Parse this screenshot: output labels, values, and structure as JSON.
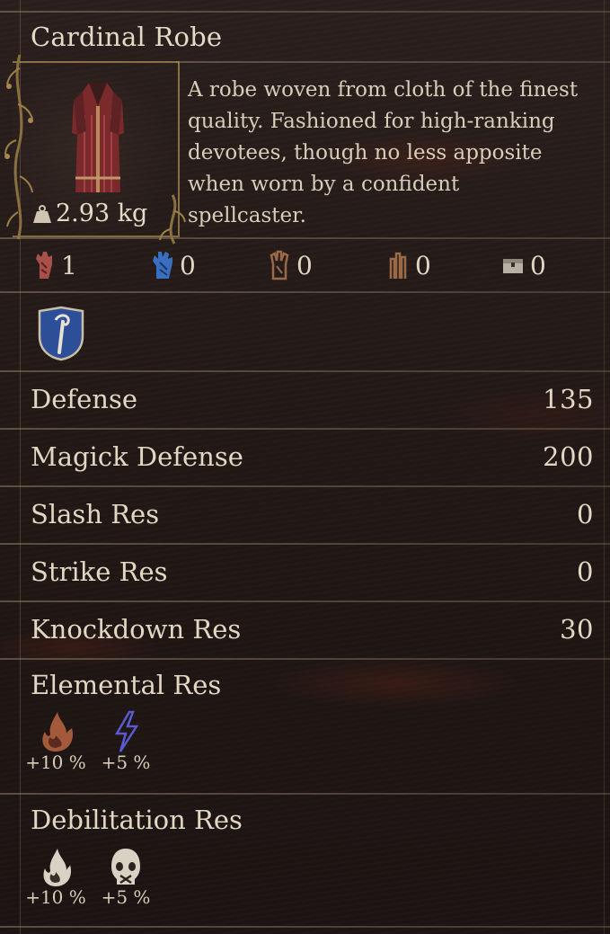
{
  "item": {
    "name": "Cardinal Robe",
    "weight": "2.93 kg",
    "description": "A robe woven from cloth of the finest quality. Fashioned for high-ranking devotees, though no less apposite when worn by a confident spellcaster."
  },
  "slots": [
    {
      "icon": "fighter-hand-icon",
      "value": "1",
      "color": "#b85a52"
    },
    {
      "icon": "mage-hand-icon",
      "value": "0",
      "color": "#3a6fbf"
    },
    {
      "icon": "thief-hand-icon",
      "value": "0",
      "color": "#9a6a48"
    },
    {
      "icon": "warrior-hand-icon",
      "value": "0",
      "color": "#9a6a48"
    },
    {
      "icon": "chest-icon",
      "value": "0",
      "color": "#b8b0a4"
    }
  ],
  "vocation_badge": {
    "icon": "mage-staff-shield-icon",
    "color": "#2d4f98"
  },
  "stats": [
    {
      "label": "Defense",
      "value": "135"
    },
    {
      "label": "Magick Defense",
      "value": "200"
    },
    {
      "label": "Slash Res",
      "value": "0"
    },
    {
      "label": "Strike Res",
      "value": "0"
    },
    {
      "label": "Knockdown Res",
      "value": "30"
    }
  ],
  "elemental": {
    "title": "Elemental Res",
    "items": [
      {
        "icon": "fire-icon",
        "value": "+10 %"
      },
      {
        "icon": "lightning-icon",
        "value": "+5 %"
      }
    ]
  },
  "debilitation": {
    "title": "Debilitation Res",
    "items": [
      {
        "icon": "burn-icon",
        "value": "+10 %"
      },
      {
        "icon": "silence-skull-icon",
        "value": "+5 %"
      }
    ]
  }
}
